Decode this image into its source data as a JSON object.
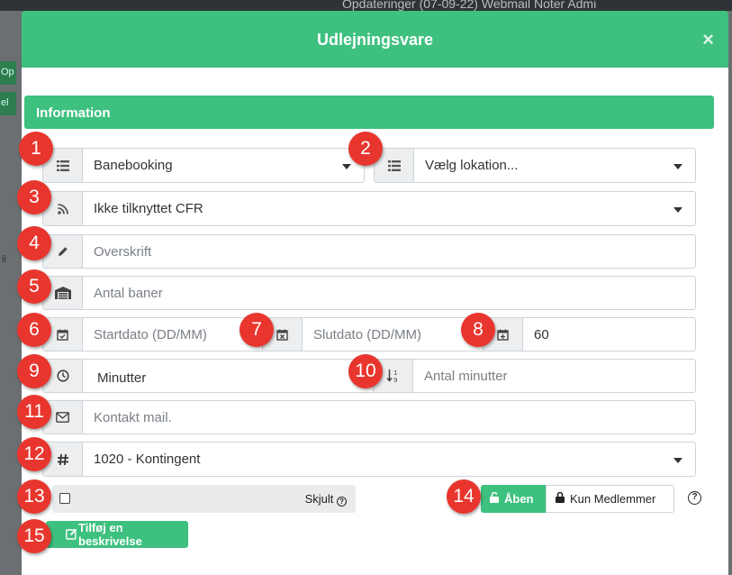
{
  "background": {
    "topbar_text": "Opdateringer (07-09-22)   Webmail   Noter   Admi",
    "left_labels": [
      "Op",
      "el",
      "li"
    ]
  },
  "modal": {
    "title": "Udlejningsvare",
    "close_symbol": "×",
    "section_title": "Information"
  },
  "form": {
    "type_select": {
      "value": "Banebooking",
      "icon": "list-icon"
    },
    "location_select": {
      "value": "Vælg lokation...",
      "icon": "list-icon"
    },
    "cfr_select": {
      "value": "Ikke tilknyttet CFR",
      "icon": "rss-icon"
    },
    "heading_input": {
      "placeholder": "Overskrift",
      "icon": "pencil-icon"
    },
    "courts_input": {
      "placeholder": "Antal baner",
      "icon": "warehouse-icon"
    },
    "start_date": {
      "placeholder": "Startdato (DD/MM)",
      "icon": "calendar-check-icon"
    },
    "end_date": {
      "placeholder": "Slutdato (DD/MM)",
      "icon": "calendar-x-icon"
    },
    "days_input": {
      "value": "60",
      "icon": "calendar-plus-icon"
    },
    "unit_select": {
      "value": "Minutter",
      "icon": "clock-icon"
    },
    "minutes_input": {
      "placeholder": "Antal minutter",
      "icon": "sort-numeric-icon"
    },
    "mail_input": {
      "placeholder": "Kontakt mail.",
      "icon": "envelope-icon"
    },
    "account_select": {
      "value": "1020 - Kontingent",
      "icon": "hash-icon"
    },
    "hidden_toggle": {
      "label": "Skjult",
      "checked": false
    },
    "access_open": {
      "label": "Åben",
      "active": true
    },
    "access_members": {
      "label": "Kun Medlemmer",
      "active": false
    },
    "help": "?",
    "add_description": "Tilføj en beskrivelse"
  },
  "badges": [
    "1",
    "2",
    "3",
    "4",
    "5",
    "6",
    "7",
    "8",
    "9",
    "10",
    "11",
    "12",
    "13",
    "14",
    "15"
  ],
  "colors": {
    "accent": "#3ec07f",
    "badge": "#e8362e",
    "addon_bg": "#eceeef"
  }
}
